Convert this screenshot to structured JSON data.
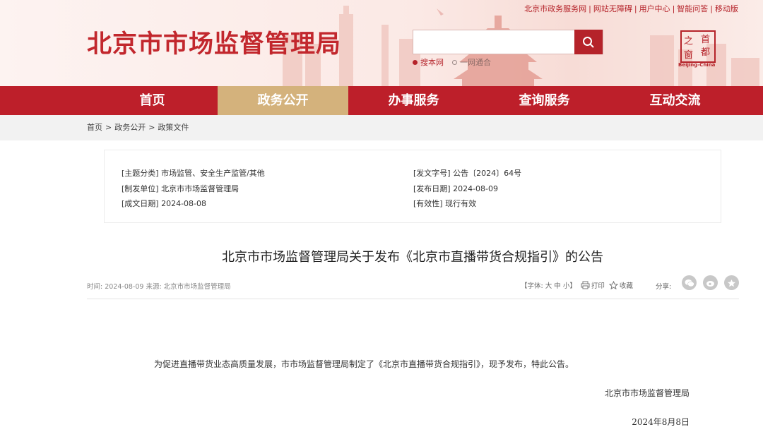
{
  "header": {
    "site_title": "北京市市场监督管理局",
    "top_links": [
      "北京市政务服务网",
      "网站无障碍",
      "用户中心",
      "智能问答",
      "移动版"
    ],
    "search": {
      "placeholder": "",
      "options": [
        "搜本网",
        "一网通合"
      ]
    },
    "logo": {
      "chars": [
        "首",
        "都",
        "之",
        "窗"
      ],
      "caption": "Beijing-China"
    }
  },
  "nav": {
    "items": [
      "首页",
      "政务公开",
      "办事服务",
      "查询服务",
      "互动交流"
    ],
    "active_index": 1
  },
  "breadcrumb": [
    "首页",
    "政务公开",
    "政策文件"
  ],
  "meta": {
    "topic": "[主题分类] 市场监管、安全生产监管/其他",
    "issuer": "[制发单位] 北京市市场监督管理局",
    "date_written": "[成文日期] 2024-08-08",
    "doc_number": "[发文字号] 公告〔2024〕64号",
    "publish_date": "[发布日期] 2024-08-09",
    "validity": "[有效性] 现行有效"
  },
  "article": {
    "title": "北京市市场监督管理局关于发布《北京市直播带货合规指引》的公告",
    "info": "时间: 2024-08-09    来源: 北京市市场监督管理局",
    "font_label": "【字体:",
    "font_sizes": [
      "大",
      "中",
      "小"
    ],
    "font_end": "】",
    "print_label": "打印",
    "fav_label": "收藏",
    "share_label": "分享:",
    "body": "为促进直播带货业态高质量发展，市市场监督管理局制定了《北京市直播带货合规指引》，现予发布，特此公告。",
    "signature": "北京市市场监督管理局",
    "sign_date": "2024年8月8日"
  },
  "colors": {
    "brand_red": "#bd1f2a",
    "active_gold": "#d4b27c"
  }
}
